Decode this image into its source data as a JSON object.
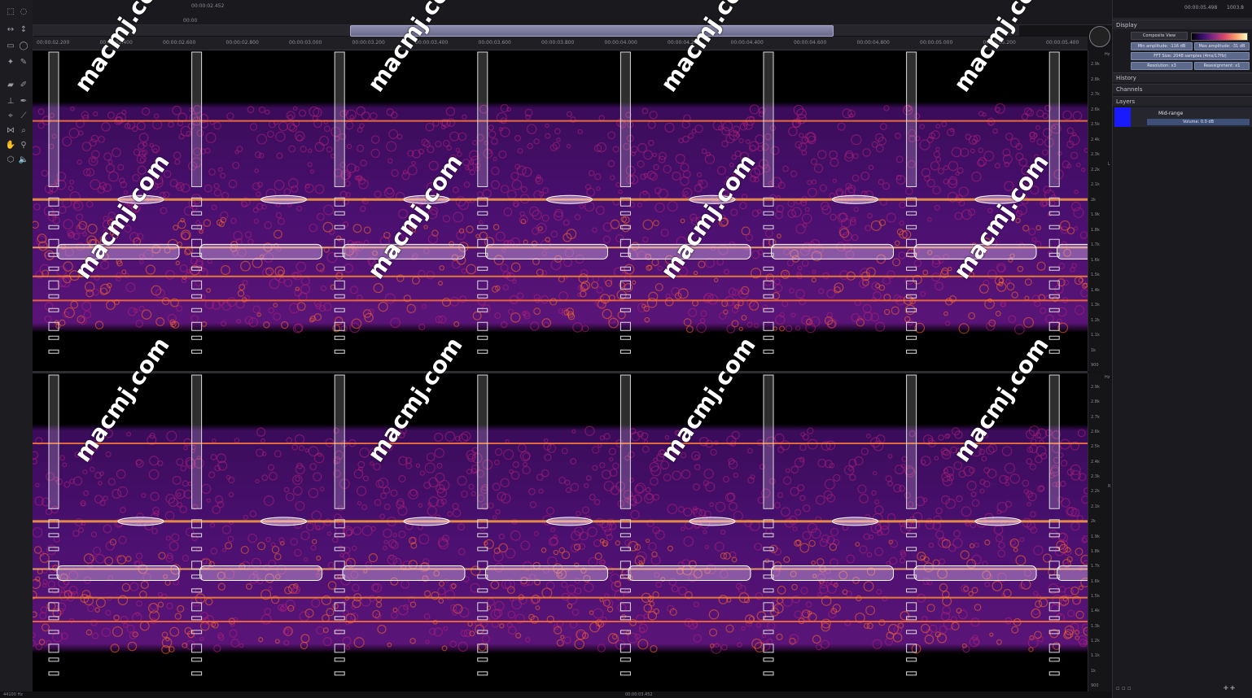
{
  "topbar": {
    "time_display": "00:00:02.452",
    "zoom_value": "00:00",
    "right_time": "00:00:05.498",
    "right_info": "1003.8"
  },
  "ruler": {
    "ticks": [
      "00:00:02.200",
      "00:00:02.400",
      "00:00:02.600",
      "00:00:02.800",
      "00:00:03.000",
      "00:00:03.200",
      "00:00:03.400",
      "00:00:03.600",
      "00:00:03.800",
      "00:00:04.000",
      "00:00:04.200",
      "00:00:04.400",
      "00:00:04.600",
      "00:00:04.800",
      "00:00:05.000",
      "00:00:05.200",
      "00:00:05.400"
    ]
  },
  "freq_axis_top": {
    "unit": "Hz",
    "labels": [
      "2.9k",
      "2.8k",
      "2.7k",
      "2.6k",
      "2.5k",
      "2.4k",
      "2.3k",
      "2.2k",
      "2.1k",
      "2k",
      "1.9k",
      "1.8k",
      "1.7k",
      "1.6k",
      "1.5k",
      "1.4k",
      "1.3k",
      "1.2k",
      "1.1k",
      "1k",
      "900"
    ],
    "channel": "L"
  },
  "freq_axis_bottom": {
    "unit": "Hz",
    "labels": [
      "2.9k",
      "2.8k",
      "2.7k",
      "2.6k",
      "2.5k",
      "2.4k",
      "2.3k",
      "2.2k",
      "2.1k",
      "2k",
      "1.9k",
      "1.8k",
      "1.7k",
      "1.6k",
      "1.5k",
      "1.4k",
      "1.3k",
      "1.2k",
      "1.1k",
      "1k",
      "900"
    ],
    "channel": "R"
  },
  "panel": {
    "display_title": "Display",
    "composite_view": "Composite View",
    "min_amplitude": "Min amplitude: -116 dB",
    "max_amplitude": "Max amplitude: -31 dB",
    "fft_size": "FFT Size: 2048 samples (4ms/17Hz)",
    "resolution": "Resolution: x3",
    "reassignment": "Reassignment: x1",
    "history_title": "History",
    "channels_title": "Channels",
    "layers_title": "Layers",
    "layer_name": "Mid-range",
    "layer_gain": "Volume: 0.0 dB"
  },
  "statusbar": {
    "sample_rate": "44100 Hz",
    "time": "00:00:03.452"
  },
  "watermarks": [
    "macmj.com",
    "macmj.com",
    "macmj.com",
    "macmj.com",
    "macmj.com",
    "macmj.com",
    "macmj.com",
    "macmj.com",
    "macmj.com",
    "macmj.com",
    "macmj.com",
    "macmj.com",
    "macmj.com",
    "macmj.com",
    "macmj.com",
    "macmj.com"
  ],
  "colors": {
    "spectrum_low": "#2a0a4a",
    "spectrum_mid": "#b0207a",
    "spectrum_high": "#ffb040",
    "selection": "#e8d8ff",
    "layer_color": "#1a1aff"
  },
  "icons": [
    "select-icon",
    "lasso-icon",
    "brush-icon",
    "eraser-icon",
    "stamp-icon",
    "pen-icon",
    "magic-wand-icon",
    "zoom-icon",
    "hand-icon",
    "speaker-icon",
    "cube-icon"
  ]
}
